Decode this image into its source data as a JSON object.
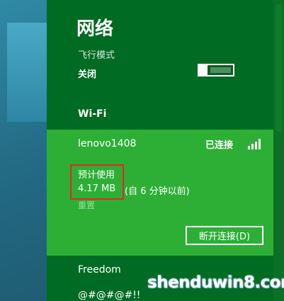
{
  "panel": {
    "title": "网络",
    "airplane_mode": {
      "label": "飞行模式",
      "state": "关闭"
    },
    "wifi_header": "Wi-Fi"
  },
  "connected_network": {
    "name": "lenovo1408",
    "status": "已连接",
    "usage_label": "预计使用",
    "usage_value": "4.17 MB",
    "usage_time": "(自 6 分钟以前)",
    "reset_link": "重置",
    "disconnect_label": "断开连接(D)"
  },
  "other_networks": [
    {
      "name": "Freedom"
    },
    {
      "name": "@#@#@#!!"
    }
  ],
  "watermark": {
    "text": "shenduwin8.com"
  },
  "colors": {
    "panel_bg": "#006B22",
    "selected_bg": "#2DAF36",
    "highlight_border": "#E8251F",
    "text": "#FFFFFF"
  },
  "icons": [
    "wifi-signal-icon",
    "toggle-switch"
  ]
}
